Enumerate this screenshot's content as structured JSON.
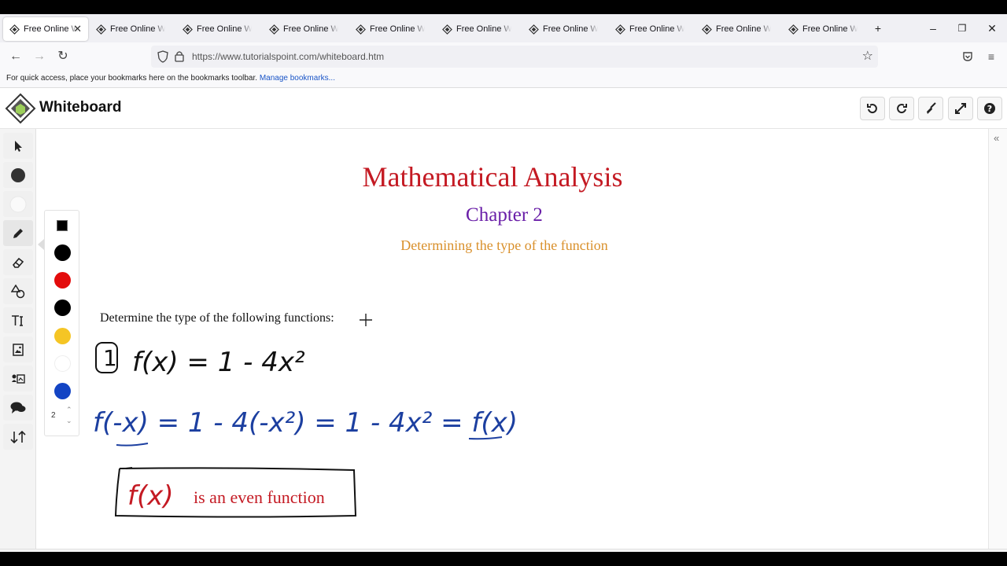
{
  "browser": {
    "tabs": [
      {
        "label": "Free Online Whiteboard",
        "active": true
      },
      {
        "label": "Free Online Whiteboard"
      },
      {
        "label": "Free Online Whiteboard"
      },
      {
        "label": "Free Online Whiteboard"
      },
      {
        "label": "Free Online Whiteboard"
      },
      {
        "label": "Free Online Whiteboard"
      },
      {
        "label": "Free Online Whiteboard"
      },
      {
        "label": "Free Online Whiteboard"
      },
      {
        "label": "Free Online Whiteboard"
      },
      {
        "label": "Free Online Whiteboard"
      }
    ],
    "url": "https://www.tutorialspoint.com/whiteboard.htm",
    "bookmarks_hint": "For quick access, place your bookmarks here on the bookmarks toolbar.",
    "bookmarks_link": "Manage bookmarks..."
  },
  "app": {
    "title": "Whiteboard"
  },
  "palette": {
    "size_value": "2",
    "colors": [
      "#000000",
      "#e30b0b",
      "#000000",
      "#f5c525",
      "#ffffff",
      "#1344c4"
    ]
  },
  "board": {
    "heading": "Mathematical Analysis",
    "chapter": "Chapter 2",
    "subtitle": "Determining the type of the function",
    "prompt": "Determine the type of the following functions:",
    "item_number": "1",
    "eq1": "f(x) = 1 - 4x²",
    "eq2": "f(-x) = 1 - 4(-x²) = 1 - 4x² = f(x)",
    "conclusion_fx": "f(x)",
    "conclusion_text": "is an even function"
  },
  "colors": {
    "heading": "#c41a23",
    "chapter": "#6a1fa8",
    "subtitle": "#d9902b",
    "ink_black": "#111111",
    "ink_blue": "#1c3fa0",
    "ink_red": "#c41a23"
  }
}
